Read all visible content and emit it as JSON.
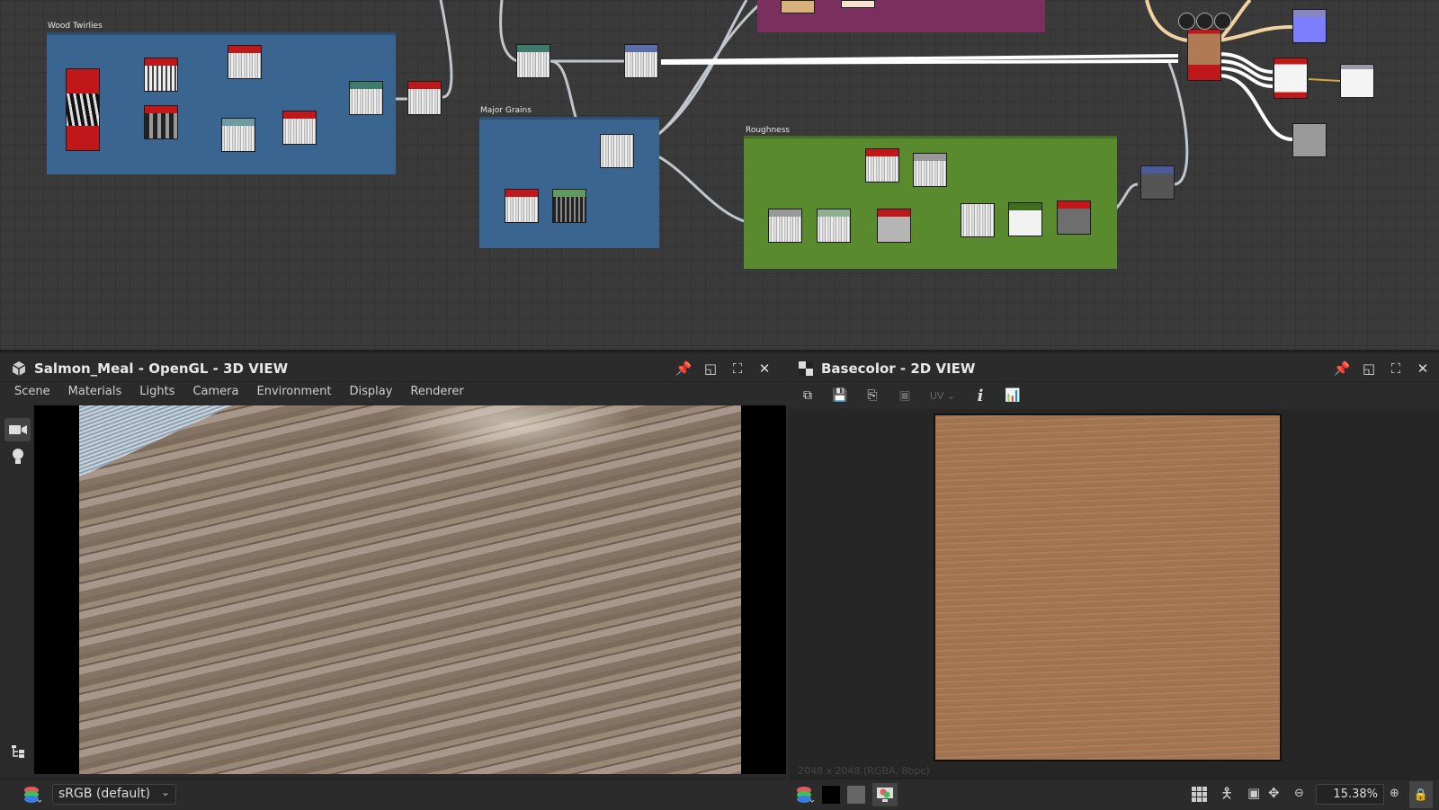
{
  "graph": {
    "frames": [
      {
        "id": "wood-twirlies",
        "title": "Wood Twirlies",
        "color": "#3a6591"
      },
      {
        "id": "major-grains",
        "title": "Major Grains",
        "color": "#3a6591"
      },
      {
        "id": "roughness",
        "title": "Roughness",
        "color": "#5a8a2e"
      },
      {
        "id": "color-frame",
        "title": "",
        "color": "#7a2f5e"
      }
    ]
  },
  "panel3d": {
    "title": "Salmon_Meal - OpenGL - 3D VIEW",
    "menu": [
      "Scene",
      "Materials",
      "Lights",
      "Camera",
      "Environment",
      "Display",
      "Renderer"
    ],
    "colorspace": "sRGB (default)",
    "icons": [
      "cube-icon",
      "pin-icon",
      "float-icon",
      "maximize-icon",
      "close-icon",
      "camera-icon",
      "light-bulb-icon",
      "hierarchy-icon",
      "layers-icon"
    ]
  },
  "panel2d": {
    "title": "Basecolor - 2D VIEW",
    "toolbar": {
      "uv_label": "UV",
      "info_label": "i"
    },
    "resolution_info": "2048 x 2048 (RGBA, 8bpc)",
    "zoom": "15.38%",
    "colors": {
      "texture": "#a87853"
    }
  }
}
